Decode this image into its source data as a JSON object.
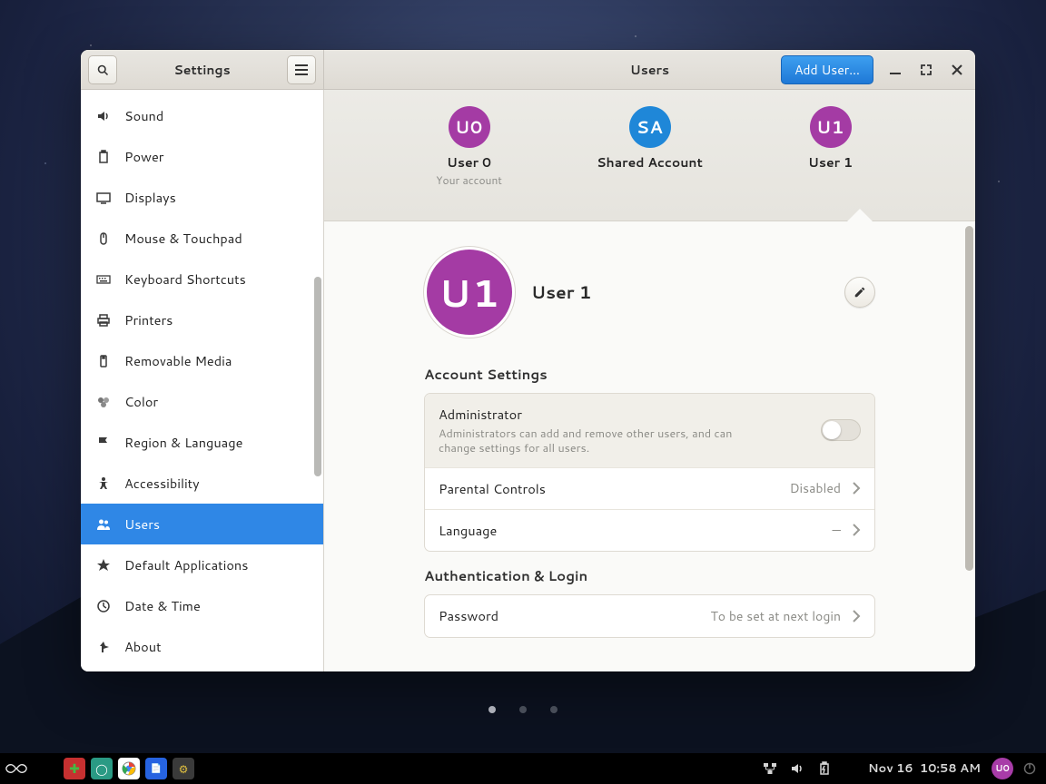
{
  "window": {
    "sidebar_title": "Settings",
    "page_title": "Users",
    "add_user_btn": "Add User…"
  },
  "sidebar": {
    "items": [
      {
        "label": "Sound",
        "icon": "sound"
      },
      {
        "label": "Power",
        "icon": "power"
      },
      {
        "label": "Displays",
        "icon": "displays"
      },
      {
        "label": "Mouse & Touchpad",
        "icon": "mouse"
      },
      {
        "label": "Keyboard Shortcuts",
        "icon": "keyboard"
      },
      {
        "label": "Printers",
        "icon": "printers"
      },
      {
        "label": "Removable Media",
        "icon": "media"
      },
      {
        "label": "Color",
        "icon": "color"
      },
      {
        "label": "Region & Language",
        "icon": "region"
      },
      {
        "label": "Accessibility",
        "icon": "accessibility"
      },
      {
        "label": "Users",
        "icon": "users"
      },
      {
        "label": "Default Applications",
        "icon": "defaults"
      },
      {
        "label": "Date & Time",
        "icon": "datetime"
      },
      {
        "label": "About",
        "icon": "about"
      }
    ],
    "active_index": 10
  },
  "users_strip": [
    {
      "initials": "U0",
      "name": "User 0",
      "sub": "Your account",
      "color": "#a43ba4"
    },
    {
      "initials": "SA",
      "name": "Shared Account",
      "sub": "",
      "color": "#1f87d8"
    },
    {
      "initials": "U1",
      "name": "User 1",
      "sub": "",
      "color": "#a43ba4"
    }
  ],
  "selected_user_index": 2,
  "profile": {
    "initials": "U1",
    "name": "User 1",
    "avatar_color": "#a43ba4"
  },
  "account_settings": {
    "title": "Account Settings",
    "admin_label": "Administrator",
    "admin_desc": "Administrators can add and remove other users, and can change settings for all users.",
    "admin_on": false,
    "parental_label": "Parental Controls",
    "parental_value": "Disabled",
    "language_label": "Language",
    "language_value": "—"
  },
  "auth": {
    "title": "Authentication & Login",
    "password_label": "Password",
    "password_value": "To be set at next login"
  },
  "taskbar": {
    "datetime": "Nov 16  10:58 AM",
    "user_initials": "U0"
  }
}
